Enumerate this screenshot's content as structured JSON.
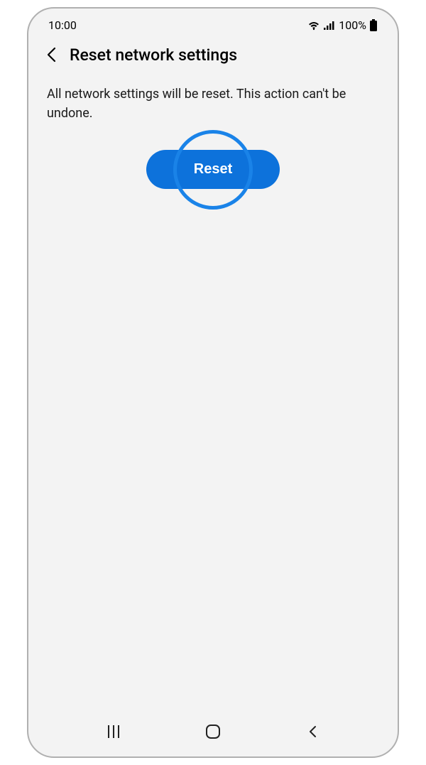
{
  "status_bar": {
    "time": "10:00",
    "battery": "100%"
  },
  "header": {
    "title": "Reset network settings"
  },
  "content": {
    "description": "All network settings will be reset. This action can't be undone.",
    "reset_button_label": "Reset"
  }
}
